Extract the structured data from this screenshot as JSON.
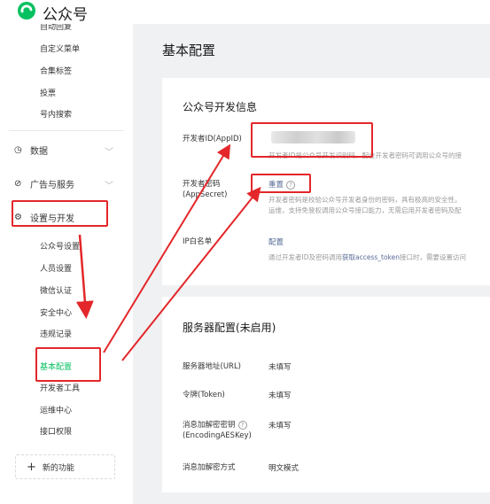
{
  "app": {
    "brand": "公众号"
  },
  "sidebar": {
    "top_items": [
      {
        "label": "自动回复"
      },
      {
        "label": "自定义菜单"
      },
      {
        "label": "合集标签"
      },
      {
        "label": "投票"
      },
      {
        "label": "号内搜索"
      }
    ],
    "groups": {
      "data": {
        "label": "数据",
        "icon": "clock-icon"
      },
      "ads": {
        "label": "广告与服务",
        "icon": "compass-icon"
      },
      "settings": {
        "label": "设置与开发",
        "icon": "gear-icon"
      }
    },
    "settings_items": [
      {
        "label": "公众号设置"
      },
      {
        "label": "人员设置"
      },
      {
        "label": "微信认证"
      },
      {
        "label": "安全中心"
      },
      {
        "label": "违规记录"
      },
      {
        "label": "基本配置"
      },
      {
        "label": "开发者工具"
      },
      {
        "label": "运维中心"
      },
      {
        "label": "接口权限"
      }
    ],
    "new_feature": "新的功能"
  },
  "main": {
    "title": "基本配置",
    "dev_card": {
      "title": "公众号开发信息",
      "appid_label": "开发者ID(AppID)",
      "appid_desc": "开发者ID是公众号开发识别码，配合开发者密码可调用公众号的接",
      "secret_label": "开发者密码(AppSecret)",
      "secret_action": "重置",
      "secret_desc_1": "开发者密码是校验公众号开发者身份的密码，具有极高的安全性。",
      "secret_desc_2": "运维，支持免登权调用公众号接口能力，无需启用开发者密码及配",
      "ip_label": "IP白名单",
      "ip_action": "配置",
      "ip_desc_pre": "通过开发者ID及密码调用",
      "ip_desc_link": "获取access_token",
      "ip_desc_post": "接口时，需要设置访问"
    },
    "server_card": {
      "title": "服务器配置(未启用)",
      "rows": [
        {
          "label": "服务器地址(URL)",
          "value": "未填写"
        },
        {
          "label": "令牌(Token)",
          "value": "未填写"
        },
        {
          "label": "消息加解密密钥",
          "label2": "(EncodingAESKey)",
          "value": "未填写"
        },
        {
          "label": "消息加解密方式",
          "value": "明文模式"
        }
      ]
    }
  },
  "colors": {
    "annotation_red": "#e3272a",
    "active_green": "#07c160",
    "link_blue": "#576b95"
  }
}
